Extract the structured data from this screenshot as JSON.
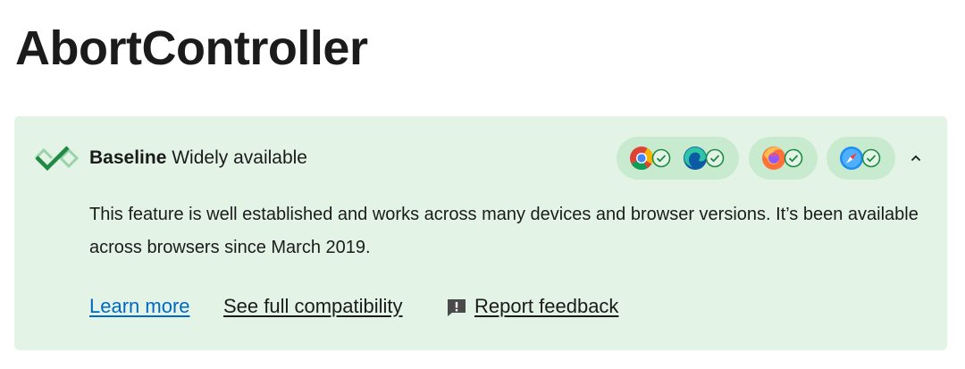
{
  "page": {
    "title": "AbortController"
  },
  "baseline": {
    "label_bold": "Baseline",
    "label_status": "Widely available",
    "description": "This feature is well established and works across many devices and browser versions. It’s been available across browsers since March 2019.",
    "browsers": [
      {
        "name": "chrome-icon",
        "supported": true
      },
      {
        "name": "edge-icon",
        "supported": true
      },
      {
        "name": "firefox-icon",
        "supported": true
      },
      {
        "name": "safari-icon",
        "supported": true
      }
    ],
    "expanded": true
  },
  "links": {
    "learn_more": "Learn more",
    "full_compat": "See full compatibility",
    "feedback": "Report feedback"
  },
  "colors": {
    "card_bg": "#e3f4e7",
    "pill_bg": "#c8eace",
    "check_green": "#1e8a44",
    "link_blue": "#0069c2"
  }
}
